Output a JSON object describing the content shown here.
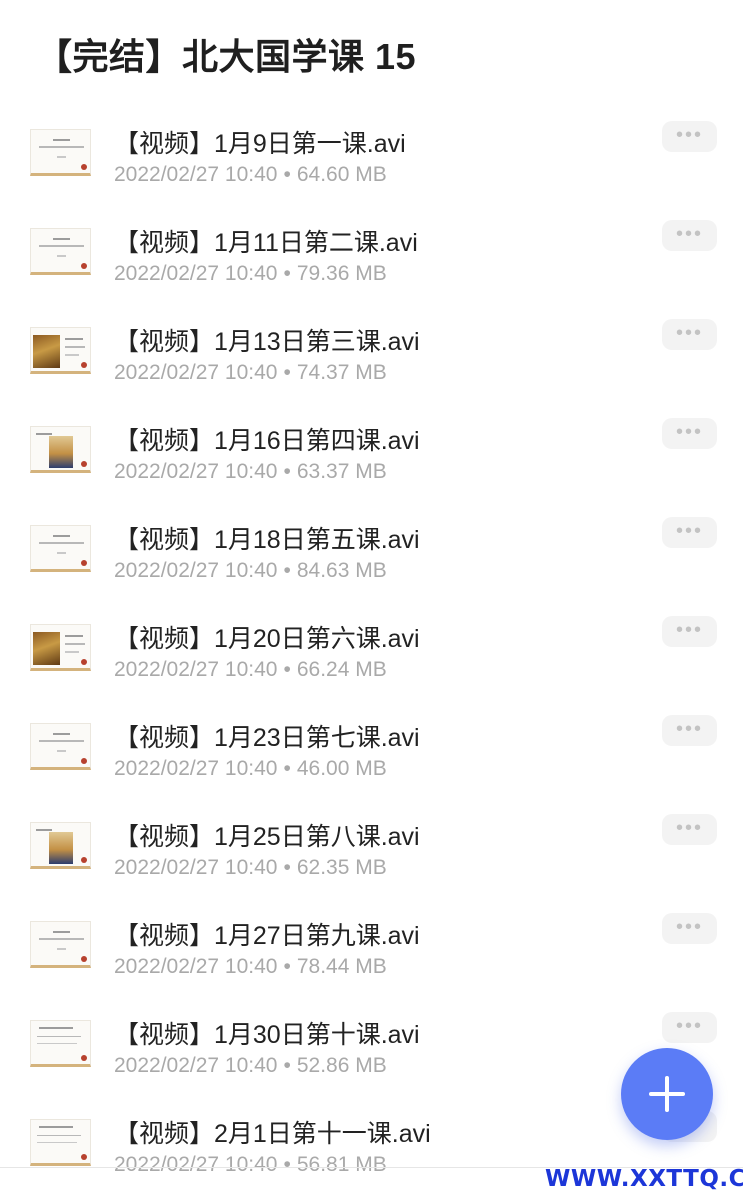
{
  "folder_title": "【完结】北大国学课 15",
  "files": [
    {
      "name": "【视频】1月9日第一课.avi",
      "date": "2022/02/27 10:40",
      "size": "64.60 MB",
      "thumb": "slide",
      "more_label": "•••"
    },
    {
      "name": "【视频】1月11日第二课.avi",
      "date": "2022/02/27 10:40",
      "size": "79.36 MB",
      "thumb": "slide",
      "more_label": "•••"
    },
    {
      "name": "【视频】1月13日第三课.avi",
      "date": "2022/02/27 10:40",
      "size": "74.37 MB",
      "thumb": "painting",
      "more_label": "•••"
    },
    {
      "name": "【视频】1月16日第四课.avi",
      "date": "2022/02/27 10:40",
      "size": "63.37 MB",
      "thumb": "portrait",
      "more_label": "•••"
    },
    {
      "name": "【视频】1月18日第五课.avi",
      "date": "2022/02/27 10:40",
      "size": "84.63 MB",
      "thumb": "slide",
      "more_label": "•••"
    },
    {
      "name": "【视频】1月20日第六课.avi",
      "date": "2022/02/27 10:40",
      "size": "66.24 MB",
      "thumb": "painting",
      "more_label": "•••"
    },
    {
      "name": "【视频】1月23日第七课.avi",
      "date": "2022/02/27 10:40",
      "size": "46.00 MB",
      "thumb": "slide",
      "more_label": "•••"
    },
    {
      "name": "【视频】1月25日第八课.avi",
      "date": "2022/02/27 10:40",
      "size": "62.35 MB",
      "thumb": "portrait",
      "more_label": "•••"
    },
    {
      "name": "【视频】1月27日第九课.avi",
      "date": "2022/02/27 10:40",
      "size": "78.44 MB",
      "thumb": "slide",
      "more_label": "•••"
    },
    {
      "name": "【视频】1月30日第十课.avi",
      "date": "2022/02/27 10:40",
      "size": "52.86 MB",
      "thumb": "textual",
      "more_label": "•••"
    },
    {
      "name": "【视频】2月1日第十一课.avi",
      "date": "2022/02/27 10:40",
      "size": "56.81 MB",
      "thumb": "textual",
      "more_label": "•••"
    }
  ],
  "meta_separator": "•",
  "fab": {
    "icon": "plus-icon",
    "color": "#5b7cf6"
  },
  "watermark": "WWW.XXTTQ.COM",
  "colors": {
    "accent": "#5b7cf6",
    "title": "#1f1f1f",
    "meta": "#a9a9a9",
    "watermark": "#1c36d8"
  }
}
